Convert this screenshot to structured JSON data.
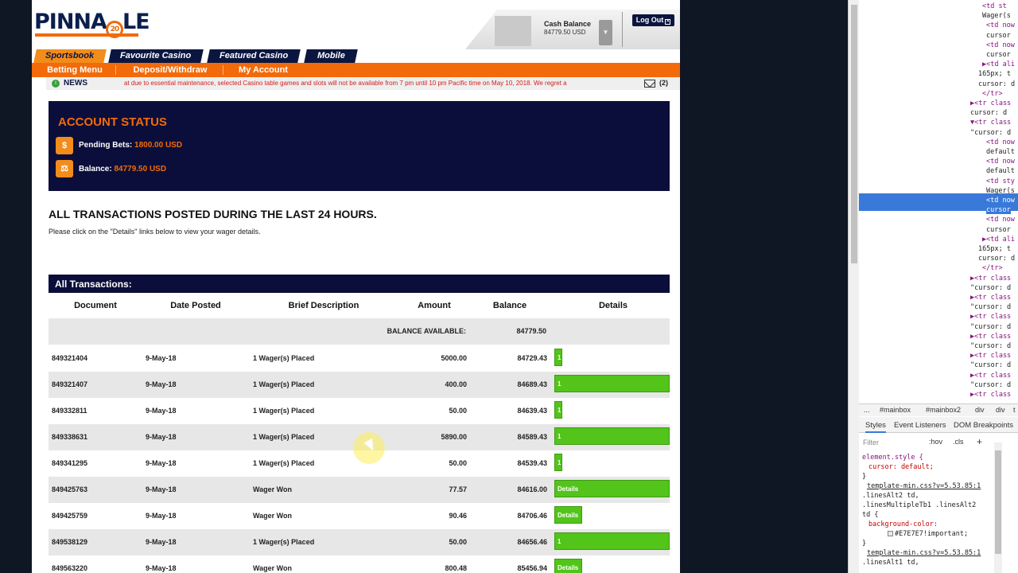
{
  "brand": {
    "logo_text_left": "PINNA",
    "logo_badge": "20",
    "logo_text_right": "LE"
  },
  "account": {
    "cash_label": "Cash Balance",
    "cash_value": "84779.50 USD",
    "logout_label": "Log Out"
  },
  "tabs": [
    "Sportsbook",
    "Favourite Casino",
    "Featured Casino",
    "Mobile"
  ],
  "orange_nav": [
    "Betting Menu",
    "Deposit/Withdraw",
    "My Account"
  ],
  "news": {
    "label": "NEWS",
    "ticker": "at due to essential maintenance, selected Casino table games and slots will not be available from 7 pm until 10 pm Pacific time on May 10, 2018. We regret a",
    "count": "(2)"
  },
  "status": {
    "title": "ACCOUNT STATUS",
    "pending_label": "Pending Bets:",
    "pending_value": "1800.00 USD",
    "balance_label": "Balance:",
    "balance_value": "84779.50 USD"
  },
  "section": {
    "title": "ALL TRANSACTIONS POSTED DURING THE LAST 24 HOURS.",
    "subtitle": "Please click on the \"Details\" links below to view your wager details."
  },
  "transactions": {
    "header": "All Transactions:",
    "columns": [
      "Document",
      "Date Posted",
      "Brief Description",
      "Amount",
      "Balance",
      "Details"
    ],
    "balance_available_label": "BALANCE AVAILABLE:",
    "balance_available_value": "84779.50",
    "rows": [
      {
        "document": "849321404",
        "date": "9-May-18",
        "description": "1 Wager(s) Placed",
        "amount": "5000.00",
        "balance": "84729.43",
        "details": "1",
        "wide": false
      },
      {
        "document": "849321407",
        "date": "9-May-18",
        "description": "1 Wager(s) Placed",
        "amount": "400.00",
        "balance": "84689.43",
        "details": "1",
        "wide": true
      },
      {
        "document": "849332811",
        "date": "9-May-18",
        "description": "1 Wager(s) Placed",
        "amount": "50.00",
        "balance": "84639.43",
        "details": "1",
        "wide": false
      },
      {
        "document": "849338631",
        "date": "9-May-18",
        "description": "1 Wager(s) Placed",
        "amount": "5890.00",
        "balance": "84589.43",
        "details": "1",
        "wide": true
      },
      {
        "document": "849341295",
        "date": "9-May-18",
        "description": "1 Wager(s) Placed",
        "amount": "50.00",
        "balance": "84539.43",
        "details": "1",
        "wide": false
      },
      {
        "document": "849425763",
        "date": "9-May-18",
        "description": "Wager Won",
        "amount": "77.57",
        "balance": "84616.00",
        "details": "Details",
        "wide": true
      },
      {
        "document": "849425759",
        "date": "9-May-18",
        "description": "Wager Won",
        "amount": "90.46",
        "balance": "84706.46",
        "details": "Details",
        "wide": false
      },
      {
        "document": "849538129",
        "date": "9-May-18",
        "description": "1 Wager(s) Placed",
        "amount": "50.00",
        "balance": "84656.46",
        "details": "1",
        "wide": true
      },
      {
        "document": "849563220",
        "date": "9-May-18",
        "description": "Wager Won",
        "amount": "800.48",
        "balance": "85456.94",
        "details": "Details",
        "wide": false
      }
    ]
  },
  "devtools": {
    "dom_lines": [
      "<td st",
      "Wager(s",
      "<td now",
      "cursor",
      "<td now",
      "cursor",
      "▶<td ali",
      "165px; t",
      "cursor: d",
      "</tr>",
      "▶<tr class",
      "cursor: d",
      "▼<tr class",
      "\"cursor: d",
      "<td now",
      "default",
      "<td now",
      "default",
      "<td sty",
      "Wager(s",
      "<td now",
      "cursor",
      "<td now",
      "cursor",
      "▶<td ali",
      "165px; t",
      "cursor: d",
      "</tr>",
      "▶<tr class",
      "\"cursor: d",
      "▶<tr class",
      "\"cursor: d",
      "▶<tr class",
      "\"cursor: d",
      "▶<tr class",
      "\"cursor: d",
      "▶<tr class",
      "\"cursor: d",
      "▶<tr class",
      "\"cursor: d",
      "▶<tr class",
      "\"cursor: d"
    ],
    "breadcrumbs": [
      "...",
      "#mainbox",
      "#mainbox2",
      "div",
      "div",
      "t"
    ],
    "tabs": [
      "Styles",
      "Event Listeners",
      "DOM Breakpoints"
    ],
    "filter_placeholder": "Filter",
    "filter_hov": ":hov",
    "filter_cls": ".cls",
    "filter_add": "+",
    "styles": [
      {
        "kind": "sel",
        "text": "element.style {"
      },
      {
        "kind": "prop",
        "text": "  cursor: default;"
      },
      {
        "kind": "plain",
        "text": "}"
      },
      {
        "kind": "link",
        "text": "template-min.css?v=5.53.85:1"
      },
      {
        "kind": "plain",
        "text": ".linesAlt2 td,"
      },
      {
        "kind": "plain",
        "text": ".linesMultipleTb1 .linesAlt2"
      },
      {
        "kind": "plain",
        "text": "td {"
      },
      {
        "kind": "prop",
        "text": "  background-color:"
      },
      {
        "kind": "swatch",
        "text": "#E7E7E7!important;"
      },
      {
        "kind": "plain",
        "text": "}"
      },
      {
        "kind": "link",
        "text": "template-min.css?v=5.53.85:1"
      },
      {
        "kind": "plain",
        "text": ".linesAlt1 td,"
      }
    ]
  },
  "colors": {
    "orange": "#f26a0a",
    "navy": "#0b0e3a",
    "green": "#52c41a",
    "row_alt": "#e7e7e7"
  }
}
